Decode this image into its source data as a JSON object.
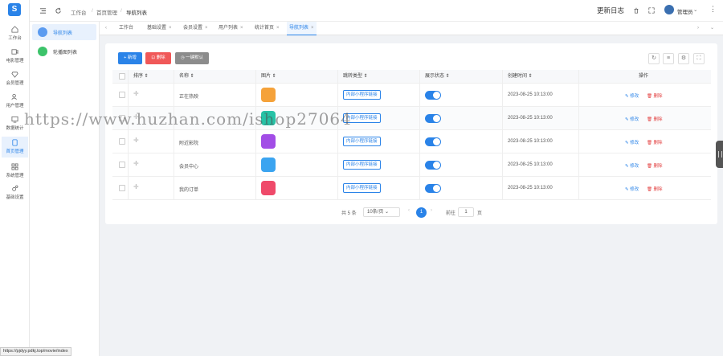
{
  "app": {
    "logo": "S"
  },
  "rail": [
    {
      "label": "工作台",
      "icon": "home-icon"
    },
    {
      "label": "电影管理",
      "icon": "video-icon"
    },
    {
      "label": "会员管理",
      "icon": "diamond-icon"
    },
    {
      "label": "用户管理",
      "icon": "users-icon"
    },
    {
      "label": "数据统计",
      "icon": "chart-icon"
    },
    {
      "label": "首页管理",
      "icon": "tablet-icon",
      "active": true
    },
    {
      "label": "系统管理",
      "icon": "grid-icon"
    },
    {
      "label": "基础设置",
      "icon": "gears-icon"
    }
  ],
  "submenu": [
    {
      "label": "导航列表",
      "color": "#5b9bf0",
      "active": true
    },
    {
      "label": "轮播图列表",
      "color": "#3cc36a"
    }
  ],
  "topbar": {
    "breadcrumb_home": "工作台",
    "breadcrumb_section": "首页管理",
    "breadcrumb_page": "导航列表",
    "changelog": "更新日志",
    "user": "管理员"
  },
  "tabs": [
    {
      "label": "工作台",
      "closable": false
    },
    {
      "label": "基础设置",
      "closable": true
    },
    {
      "label": "会员设置",
      "closable": true
    },
    {
      "label": "用户列表",
      "closable": true
    },
    {
      "label": "统计首页",
      "closable": true
    },
    {
      "label": "导航列表",
      "closable": true,
      "active": true
    }
  ],
  "toolbar": {
    "add": "+ 新增",
    "delete": "删除",
    "expand": "一键默认"
  },
  "table": {
    "headers": [
      "排序",
      "名称",
      "图片",
      "跳转类型",
      "展示状态",
      "创建时间",
      "操作"
    ],
    "rows": [
      {
        "name": "正在热映",
        "type": "内部小程序链接",
        "time": "2023-08-25 10:13:00",
        "thumb_color": "#f5a23a"
      },
      {
        "name": "",
        "type": "内部小程序链接",
        "time": "2023-08-25 10:13:00",
        "thumb_color": "#27c2a6"
      },
      {
        "name": "附近影院",
        "type": "内部小程序链接",
        "time": "2023-08-25 10:13:00",
        "thumb_color": "#a24de6"
      },
      {
        "name": "会员中心",
        "type": "内部小程序链接",
        "time": "2023-08-25 10:13:00",
        "thumb_color": "#3ba4f0"
      },
      {
        "name": "我的订单",
        "type": "内部小程序链接",
        "time": "2023-08-25 10:13:00",
        "thumb_color": "#ef4a6a"
      }
    ],
    "edit_label": "修改",
    "delete_label": "删除"
  },
  "pagination": {
    "total": "共 5 条",
    "page_size": "10条/页",
    "current": "1",
    "goto_prefix": "前往",
    "goto_value": "1",
    "goto_suffix": "页"
  },
  "status_url": "https://pjdyy.pdkj.top/movie/index",
  "watermark": "https://www.huzhan.com/ishop27064"
}
